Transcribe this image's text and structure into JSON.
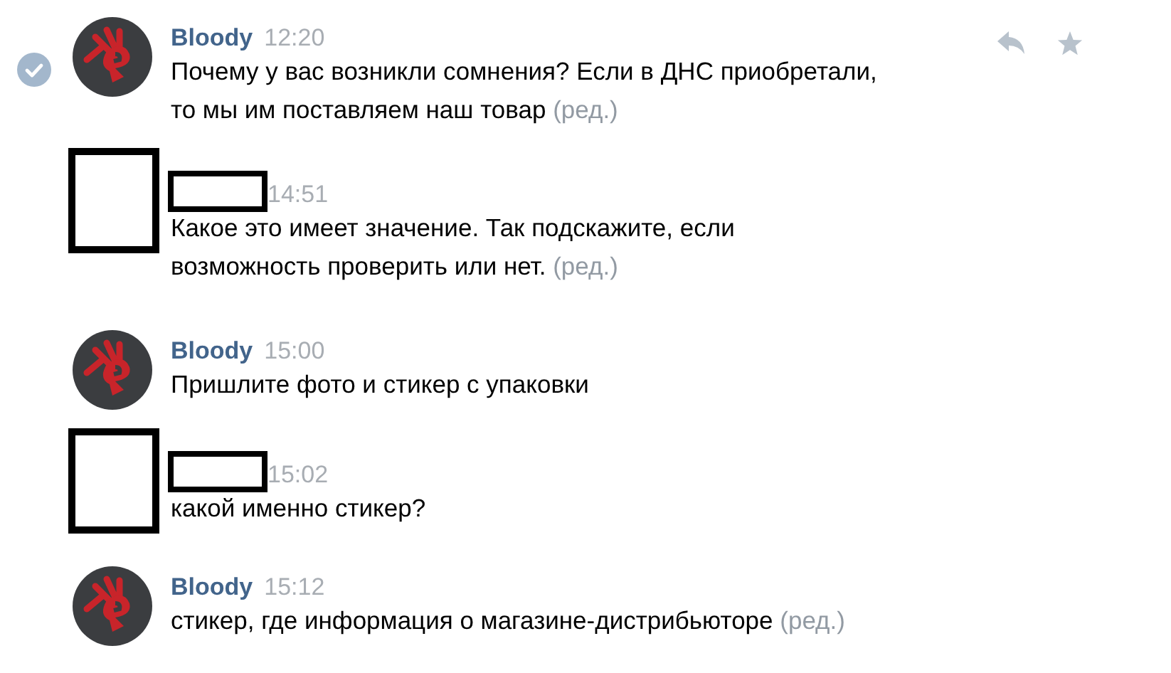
{
  "messages": [
    {
      "kind": "named",
      "author": "Bloody",
      "time": "12:20",
      "selected": true,
      "lines": [
        "Почему у вас возникли сомнения? Если в ДНС приобретали,",
        "то мы им поставляем наш товар"
      ],
      "edited_mark": "(ред.)"
    },
    {
      "kind": "redacted",
      "time": "14:51",
      "selected": false,
      "lines": [
        "Какое это имеет значение. Так подскажите, если",
        "возможность проверить или нет."
      ],
      "edited_mark": "(ред.)"
    },
    {
      "kind": "named",
      "author": "Bloody",
      "time": "15:00",
      "selected": false,
      "lines": [
        "Пришлите фото и стикер с упаковки"
      ]
    },
    {
      "kind": "redacted",
      "time": "15:02",
      "selected": false,
      "lines": [
        "какой именно стикер?"
      ]
    },
    {
      "kind": "named",
      "author": "Bloody",
      "time": "15:12",
      "selected": false,
      "lines": [
        "стикер, где информация о магазине-дистрибьюторе"
      ],
      "edited_mark": "(ред.)"
    }
  ]
}
